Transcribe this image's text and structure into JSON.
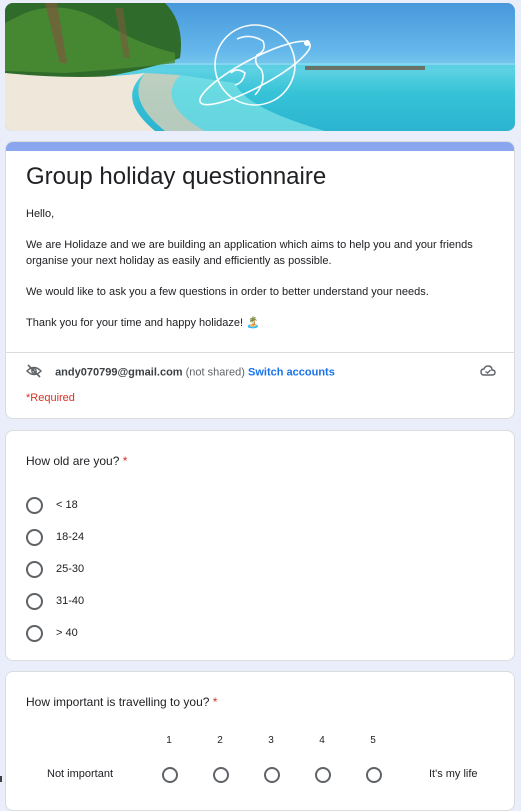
{
  "form": {
    "title": "Group holiday questionnaire",
    "description": [
      "Hello,",
      "We are Holidaze and we are building an application which aims to help you and your friends organise your next holiday as easily and efficiently as possible.",
      "We would like to ask you a few questions in order to better understand your needs.",
      "Thank you for your time and happy holidaze! 🏝️"
    ],
    "account": {
      "email": "andy070799@gmail.com",
      "shared_note": "(not shared)",
      "switch_label": "Switch accounts"
    },
    "required_note": "*Required",
    "accent_color": "#8aa6ee"
  },
  "questions": [
    {
      "title": "How old are you?",
      "required_mark": "*",
      "options": [
        "< 18",
        "18-24",
        "25-30",
        "31-40",
        "> 40"
      ]
    },
    {
      "title": "How important is travelling to you?",
      "required_mark": "*",
      "scale": [
        "1",
        "2",
        "3",
        "4",
        "5"
      ],
      "low_label": "Not important",
      "high_label": "It's my life"
    }
  ]
}
